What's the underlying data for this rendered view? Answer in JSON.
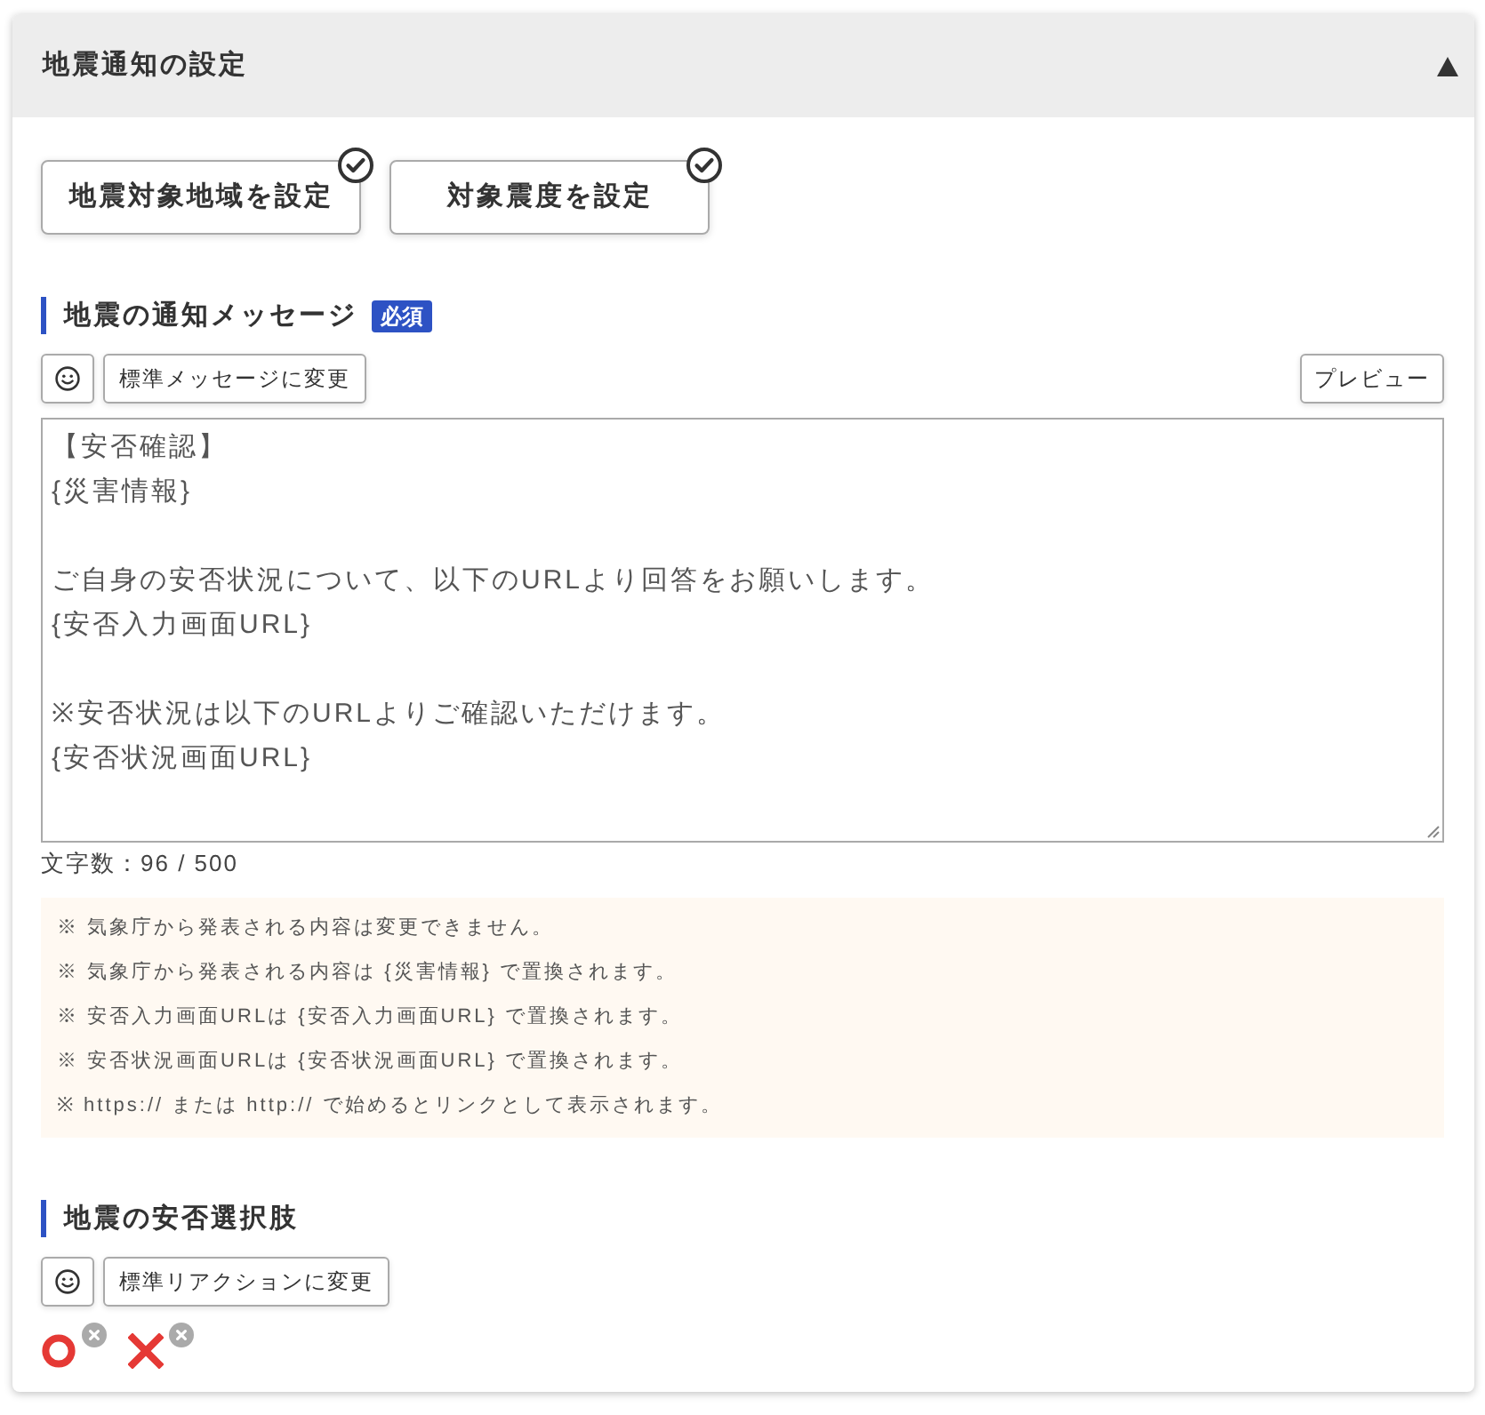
{
  "panel": {
    "title": "地震通知の設定",
    "expanded": true
  },
  "setting_buttons": [
    {
      "label": "地震対象地域を設定",
      "checked": true
    },
    {
      "label": "対象震度を設定",
      "checked": true
    }
  ],
  "message_section": {
    "heading": "地震の通知メッセージ",
    "required_badge": "必須",
    "reset_button": "標準メッセージに変更",
    "preview_button": "プレビュー",
    "message": "【安否確認】\n{災害情報}\n\nご自身の安否状況について、以下のURLより回答をお願いします。\n{安否入力画面URL}\n\n※安否状況は以下のURLよりご確認いただけます。\n{安否状況画面URL}",
    "char_count": "文字数：96 / 500",
    "notes": [
      "※ 気象庁から発表される内容は変更できません。",
      "※ 気象庁から発表される内容は {災害情報} で置換されます。",
      "※ 安否入力画面URLは {安否入力画面URL} で置換されます。",
      "※ 安否状況画面URLは {安否状況画面URL} で置換されます。",
      "※ https:// または http:// で始めるとリンクとして表示されます。"
    ]
  },
  "choices_section": {
    "heading": "地震の安否選択肢",
    "reset_button": "標準リアクションに変更",
    "reactions": [
      {
        "kind": "circle"
      },
      {
        "kind": "cross"
      }
    ]
  }
}
